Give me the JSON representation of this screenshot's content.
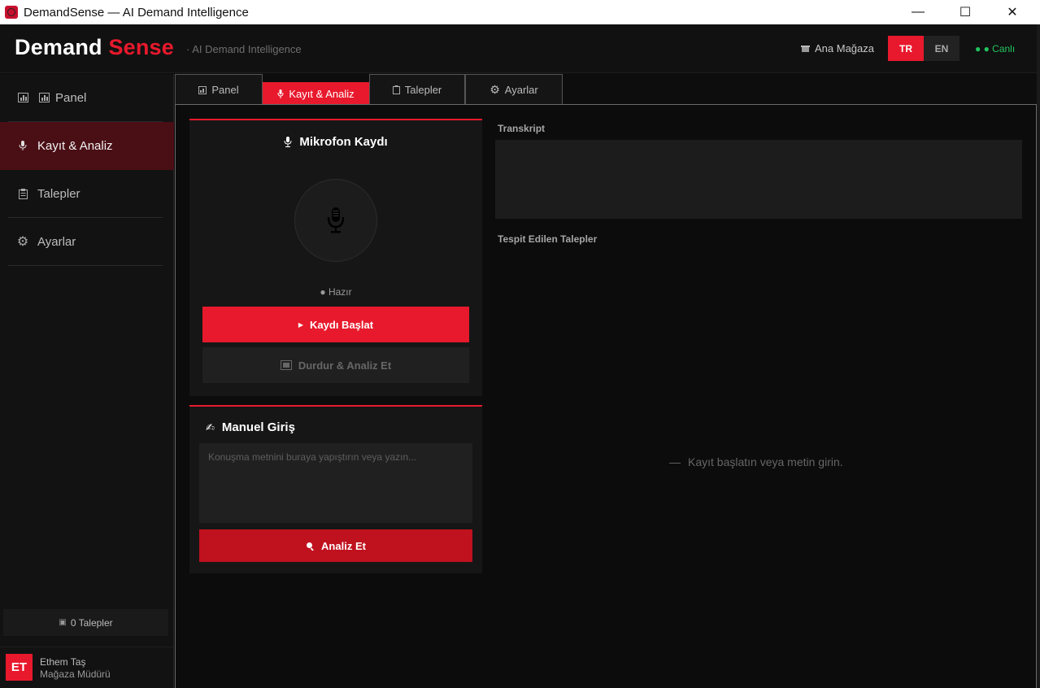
{
  "window": {
    "title": "DemandSense — AI Demand Intelligence"
  },
  "header": {
    "brand_part1": "Demand",
    "brand_part2": "Sense",
    "tagline": "· AI Demand Intelligence",
    "store": "Ana Mağaza",
    "lang_tr": "TR",
    "lang_en": "EN",
    "live": "● ● Canlı",
    "accent_color": "#e8192c"
  },
  "sidebar": {
    "items": [
      {
        "label": "Panel",
        "icon": "bar-chart-icon"
      },
      {
        "label": "Kayıt & Analiz",
        "icon": "microphone-icon"
      },
      {
        "label": "Talepler",
        "icon": "clipboard-icon"
      },
      {
        "label": "Ayarlar",
        "icon": "gear-icon"
      }
    ],
    "request_count": "0 Talepler",
    "user": {
      "initials": "ET",
      "name": "Ethem Taş",
      "role": "Mağaza Müdürü"
    }
  },
  "tabs": [
    {
      "label": "Panel"
    },
    {
      "label": "Kayıt & Analiz"
    },
    {
      "label": "Talepler"
    },
    {
      "label": "Ayarlar"
    }
  ],
  "mic_card": {
    "title": "Mikrofon Kaydı",
    "status": "● Hazır",
    "start_label": "Kaydı Başlat",
    "stop_label": "Durdur & Analiz Et"
  },
  "manual_card": {
    "title": "Manuel Giriş",
    "placeholder": "Konuşma metnini buraya yapıştırın veya yazın...",
    "analyze_label": "Analiz Et"
  },
  "results": {
    "transcript_label": "Transkript",
    "detected_label": "Tespit Edilen Talepler",
    "empty_dash": "—",
    "empty_message": "Kayıt başlatın veya metin girin."
  }
}
